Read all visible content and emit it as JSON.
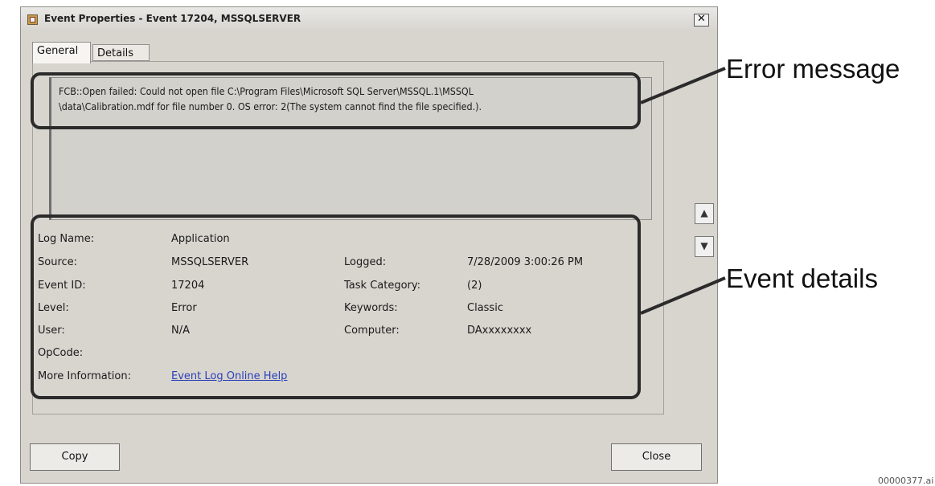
{
  "window": {
    "title": "Event Properties - Event 17204, MSSQLSERVER",
    "close_symbol": "✕"
  },
  "tabs": [
    {
      "label": "General"
    },
    {
      "label": "Details"
    }
  ],
  "error_message": {
    "line1": "FCB::Open failed: Could not open file C:\\Program Files\\Microsoft SQL Server\\MSSQL.1\\MSSQL",
    "line2": "\\data\\Calibration.mdf for file number 0.  OS error: 2(The system cannot find the file specified.)."
  },
  "details": {
    "log_name_label": "Log Name:",
    "log_name_value": "Application",
    "source_label": "Source:",
    "source_value": "MSSQLSERVER",
    "logged_label": "Logged:",
    "logged_value": "7/28/2009 3:00:26 PM",
    "event_id_label": "Event ID:",
    "event_id_value": "17204",
    "task_category_label": "Task Category:",
    "task_category_value": "(2)",
    "level_label": "Level:",
    "level_value": "Error",
    "keywords_label": "Keywords:",
    "keywords_value": "Classic",
    "user_label": "User:",
    "user_value": "N/A",
    "computer_label": "Computer:",
    "computer_value": "DAxxxxxxxx",
    "opcode_label": "OpCode:",
    "more_info_label": "More Information:",
    "more_info_link": "Event Log Online Help"
  },
  "buttons": {
    "copy": "Copy",
    "close": "Close",
    "up_symbol": "▲",
    "down_symbol": "▼"
  },
  "annotations": {
    "error_message": "Error message",
    "event_details": "Event details"
  },
  "footer": "00000377.ai",
  "icons": [
    "app-icon",
    "close-icon",
    "arrow-up-icon",
    "arrow-down-icon"
  ]
}
